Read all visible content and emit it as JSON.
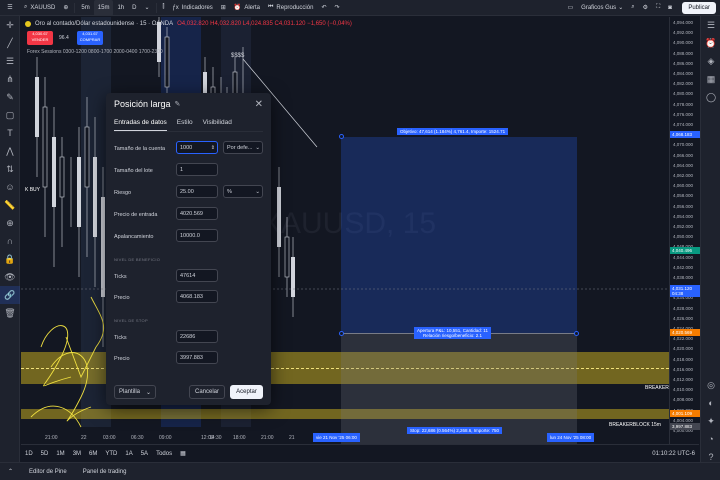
{
  "topbar": {
    "symbol": "XAUUSD",
    "timeframes": [
      "5m",
      "15m",
      "1h",
      "D"
    ],
    "active_timeframe": "15m",
    "indicators": "Indicadores",
    "alert": "Alerta",
    "replay": "Reproducción",
    "layout_name": "Graficos Gus",
    "publish": "Publicar"
  },
  "legend": {
    "title": "Oro al contado/Dólar estadounidense · 15 · OANDA",
    "ohlc": "O4,032.820 H4,032.820 L4,024.835 C4,031.120 −1,650 (−0,04%)",
    "sell_price": "4,030.67",
    "sell_label": "VENDER",
    "spread": "96.4",
    "buy_price": "4,031.67",
    "buy_label": "COMPRAR",
    "sessions": "Forex Sessions 0300-1200 0800-1700 2000-0400 1700-2300",
    "kbuy": "K BUY",
    "watermark": "XAUUSD, 15"
  },
  "price_axis": {
    "labels": [
      "4,094.000",
      "4,092.000",
      "4,090.000",
      "4,088.000",
      "4,086.000",
      "4,084.000",
      "4,082.000",
      "4,080.000",
      "4,078.000",
      "4,076.000",
      "4,074.000",
      "4,072.000",
      "4,070.000",
      "4,066.000",
      "4,064.000",
      "4,062.000",
      "4,060.000",
      "4,058.000",
      "4,056.000",
      "4,054.000",
      "4,052.000",
      "4,050.000",
      "4,048.000",
      "4,044.000",
      "4,042.000",
      "4,038.000",
      "4,036.000",
      "4,034.000",
      "4,028.000",
      "4,026.000",
      "4,024.000",
      "4,022.000",
      "4,020.000",
      "4,018.000",
      "4,016.000",
      "4,012.000",
      "4,010.000",
      "4,008.000",
      "4,006.000",
      "4,004.000",
      "4,000.000"
    ],
    "target_tag": "4,068.183",
    "mid_tag": "4,040.496",
    "current_tag": "4,031.120",
    "current_sub": "04:38",
    "entry_tag": "4,020.569",
    "stop_tag1": "4,001.109",
    "stop_tag2": "3,997.883"
  },
  "time_axis": {
    "labels": [
      "21:00",
      "22",
      "03:00",
      "06:30",
      "09:00",
      "12:00",
      "14:30",
      "18:00",
      "21:00",
      "21"
    ],
    "start_tag": "vie 21 Nov '25  06:00",
    "end_tag": "lun 24 Nov '25  08:00"
  },
  "zones": {
    "target_label": "Objetivo: 47,614 (1.184%) 4,761.4, Importe: 1524.71",
    "entry_label_1": "Apertura P&L: 10,551, Cantidad: 11",
    "entry_label_2": "Relación riesgo/beneficio: 2.1",
    "stop_label": "Stop: 22,686 (0.564%) 2,268.6, Importe: 750",
    "breaker_1": "BREAKER",
    "breaker_2": "BREAKERBLOCK 15m"
  },
  "dialog": {
    "title": "Posición larga",
    "tabs": [
      "Entradas de datos",
      "Estilo",
      "Visibilidad"
    ],
    "account_size_label": "Tamaño de la cuenta",
    "account_size_value": "1000",
    "account_mode": "Por defe...",
    "lot_size_label": "Tamaño del lote",
    "lot_size_value": "1",
    "risk_label": "Riesgo",
    "risk_value": "25.00",
    "risk_unit": "%",
    "entry_label": "Precio de entrada",
    "entry_value": "4020.569",
    "leverage_label": "Apalancamiento",
    "leverage_value": "10000.0",
    "profit_section": "NIVEL DE BENEFICIO",
    "profit_ticks_label": "Ticks",
    "profit_ticks_value": "47614",
    "profit_price_label": "Precio",
    "profit_price_value": "4068.183",
    "stop_section": "NIVEL DE STOP",
    "stop_ticks_label": "Ticks",
    "stop_ticks_value": "22686",
    "stop_price_label": "Precio",
    "stop_price_value": "3997.883",
    "template": "Plantilla",
    "cancel": "Cancelar",
    "accept": "Aceptar"
  },
  "bottom_bar": {
    "ranges": [
      "1D",
      "5D",
      "1M",
      "3M",
      "6M",
      "YTD",
      "1A",
      "5A",
      "Todos"
    ],
    "clock": "01:10:22 UTC-6"
  },
  "footer": {
    "items": [
      "Editor de Pine",
      "Panel de trading"
    ]
  },
  "colors": {
    "background": "#131722",
    "panel": "#1e222d",
    "accent": "#2962ff",
    "down": "#f23645",
    "up": "#089981",
    "zone_yellow": "#e6c81e"
  }
}
